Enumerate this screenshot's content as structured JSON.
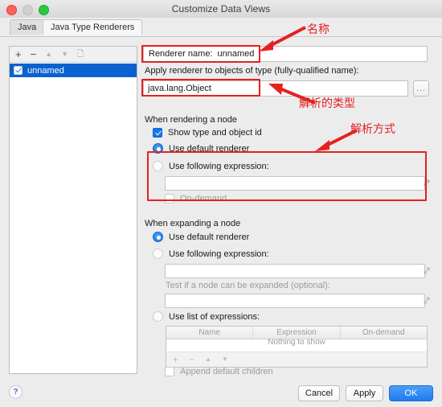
{
  "window": {
    "title": "Customize Data Views",
    "traffic_lights": [
      "close-red",
      "minimize-gray",
      "zoom-green"
    ]
  },
  "tabs": [
    {
      "label": "Java",
      "selected": false
    },
    {
      "label": "Java Type Renderers",
      "selected": true
    }
  ],
  "left_panel": {
    "toolbar": [
      "+",
      "−",
      "▲",
      "▼",
      "copy-icon"
    ],
    "items": [
      {
        "label": "unnamed",
        "checked": true,
        "selected": true
      }
    ]
  },
  "right_panel": {
    "renderer_name_label": "Renderer name:",
    "renderer_name_value": "unnamed",
    "apply_label": "Apply renderer to objects of type (fully-qualified name):",
    "type_value": "java.lang.Object",
    "browse_button": "...",
    "rendering": {
      "heading": "When rendering a node",
      "show_type_label": "Show type and object id",
      "show_type_checked": true,
      "use_default_label": "Use default renderer",
      "use_default_selected": true,
      "use_expression_label": "Use following expression:",
      "use_expression_selected": false,
      "expression_value": "",
      "on_demand_label": "On-demand",
      "on_demand_checked": false
    },
    "expanding": {
      "heading": "When expanding a node",
      "use_default_label": "Use default renderer",
      "use_default_selected": true,
      "use_expression_label": "Use following expression:",
      "use_expression_selected": false,
      "expression_value": "",
      "test_label": "Test if a node can be expanded (optional):",
      "test_value": "",
      "use_list_label": "Use list of expressions:",
      "use_list_selected": false,
      "table": {
        "columns": [
          "Name",
          "Expression",
          "On-demand"
        ],
        "rows": [],
        "empty_text": "Nothing to show",
        "toolbar": [
          "+",
          "−",
          "▲",
          "▼"
        ]
      },
      "append_children_label": "Append default children",
      "append_children_checked": false
    }
  },
  "footer": {
    "help": "?",
    "cancel": "Cancel",
    "apply": "Apply",
    "ok": "OK"
  },
  "annotations": [
    {
      "text": "名称",
      "meaning": "name"
    },
    {
      "text": "解析的类型",
      "meaning": "parsed-type"
    },
    {
      "text": "解析方式",
      "meaning": "parsing-method"
    }
  ],
  "colors": {
    "accent": "#1477e6",
    "selection": "#0a62d0",
    "annotation": "#e62020",
    "window_bg": "#ececec"
  }
}
